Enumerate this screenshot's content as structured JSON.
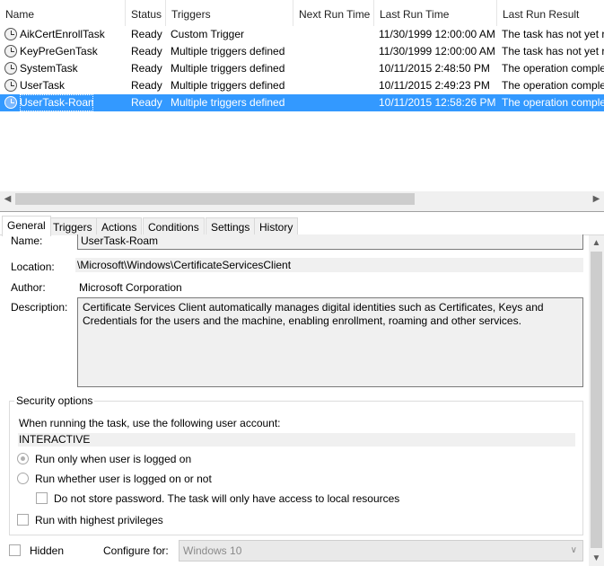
{
  "task_list": {
    "columns": [
      "Name",
      "Status",
      "Triggers",
      "Next Run Time",
      "Last Run Time",
      "Last Run Result"
    ],
    "rows": [
      {
        "name": "AikCertEnrollTask",
        "status": "Ready",
        "triggers": "Custom Trigger",
        "next_run": "",
        "last_run": "11/30/1999 12:00:00 AM",
        "result": "The task has not yet run."
      },
      {
        "name": "KeyPreGenTask",
        "status": "Ready",
        "triggers": "Multiple triggers defined",
        "next_run": "",
        "last_run": "11/30/1999 12:00:00 AM",
        "result": "The task has not yet run."
      },
      {
        "name": "SystemTask",
        "status": "Ready",
        "triggers": "Multiple triggers defined",
        "next_run": "",
        "last_run": "10/11/2015 2:48:50 PM",
        "result": "The operation completed successfully."
      },
      {
        "name": "UserTask",
        "status": "Ready",
        "triggers": "Multiple triggers defined",
        "next_run": "",
        "last_run": "10/11/2015 2:49:23 PM",
        "result": "The operation completed successfully."
      },
      {
        "name": "UserTask-Roam",
        "status": "Ready",
        "triggers": "Multiple triggers defined",
        "next_run": "",
        "last_run": "10/11/2015 12:58:26 PM",
        "result": "The operation completed successfully."
      }
    ],
    "selected_index": 4
  },
  "tabs": [
    "General",
    "Triggers",
    "Actions",
    "Conditions",
    "Settings",
    "History"
  ],
  "active_tab": "General",
  "general": {
    "name_label": "Name:",
    "name_value": "UserTask-Roam",
    "location_label": "Location:",
    "location_value": "\\Microsoft\\Windows\\CertificateServicesClient",
    "author_label": "Author:",
    "author_value": "Microsoft Corporation",
    "description_label": "Description:",
    "description_value": "Certificate Services Client automatically manages digital identities such as Certificates, Keys and Credentials for the users and the machine, enabling enrollment, roaming and other services.",
    "security": {
      "title": "Security options",
      "account_prompt": "When running the task, use the following user account:",
      "account_value": "INTERACTIVE",
      "run_only_logged_on": "Run only when user is logged on",
      "run_whether_logged_on": "Run whether user is logged on or not",
      "do_not_store_password": "Do not store password.  The task will only have access to local resources",
      "run_highest": "Run with highest privileges"
    },
    "hidden_label": "Hidden",
    "configure_label": "Configure for:",
    "configure_value": "Windows 10"
  }
}
